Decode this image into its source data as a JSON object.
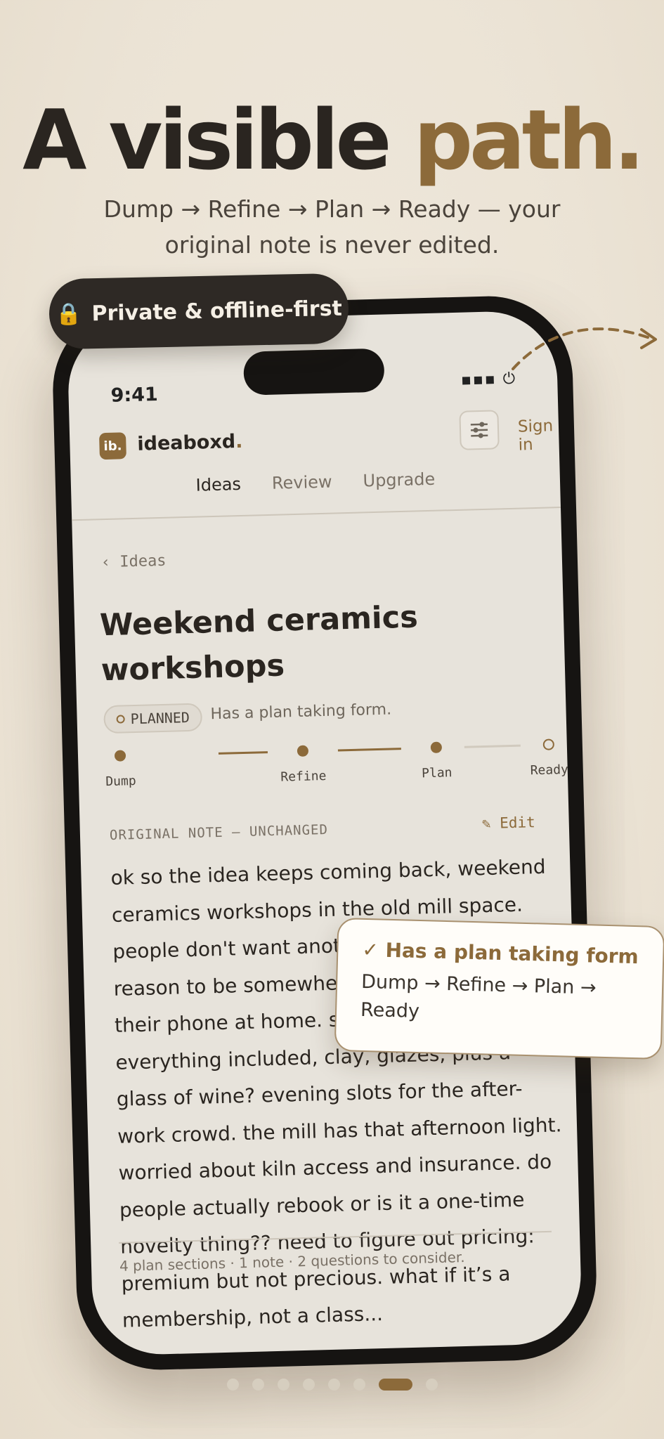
{
  "hero": {
    "headline_main": "A visible",
    "headline_accent": "path.",
    "subhead": "Dump → Refine → Plan → Ready — your original note is never edited."
  },
  "badge": {
    "icon": "lock-icon",
    "label": "Private & offline-first"
  },
  "status_bar": {
    "time": "9:41",
    "icons": "▪▪▪ ⏻"
  },
  "app": {
    "logo_mark": "ib.",
    "logo_name": "ideaboxd",
    "logo_dot": ".",
    "sign_in": "Sign in",
    "tabs": [
      {
        "label": "Ideas",
        "active": true
      },
      {
        "label": "Review",
        "active": false
      },
      {
        "label": "Upgrade",
        "active": false
      }
    ]
  },
  "idea": {
    "back_label": "‹ Ideas",
    "title": "Weekend ceramics workshops",
    "status": "PLANNED",
    "status_note": "Has a plan taking form.",
    "steps": [
      {
        "label": "Dump",
        "done": true
      },
      {
        "label": "Refine",
        "done": true
      },
      {
        "label": "Plan",
        "done": true
      },
      {
        "label": "Ready",
        "done": false
      }
    ],
    "original_label": "ORIGINAL NOTE — UNCHANGED",
    "edit_label": "✎ Edit",
    "note_body": "ok so the idea keeps coming back, weekend ceramics workshops in the old mill space. people don't want another class, they want a reason to be somewhere that's not busy and their phone at home. small groups, everything included, clay, glazes, plus a glass of wine? evening slots for the after-work crowd. the mill has that afternoon light. worried about kiln access and insurance. do people actually rebook or is it a one-time novelty thing?? need to figure out pricing: premium but not precious. what if it’s a membership, not a class...",
    "footer": "4 plan sections · 1 note · 2 questions to consider."
  },
  "callout": {
    "title": "✓ Has a plan taking form",
    "body": "Dump → Refine → Plan → Ready"
  },
  "pager": {
    "total": 8,
    "active_index": 6
  },
  "colors": {
    "accent": "#8c6a3a",
    "dark": "#2a2520",
    "background": "#ebe3d5"
  }
}
